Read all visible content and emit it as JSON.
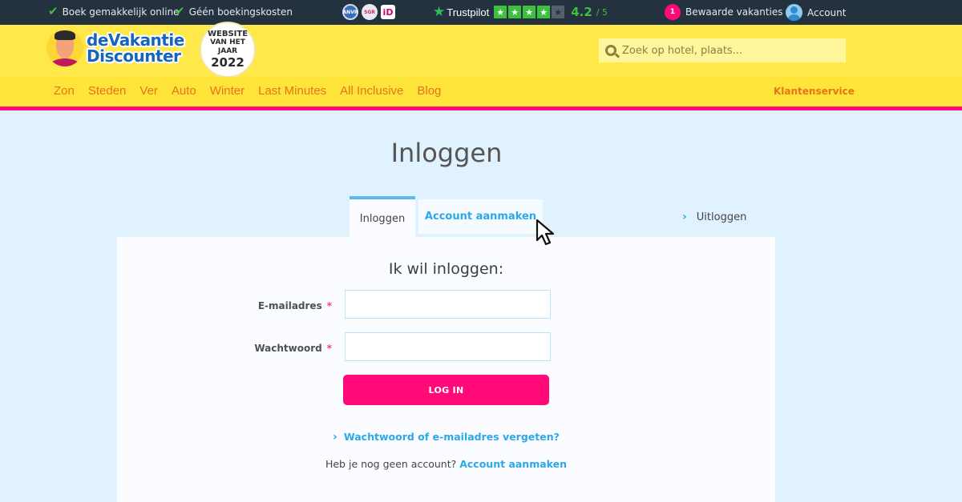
{
  "topbar": {
    "usps": [
      "Boek gemakkelijk online",
      "Géén boekingskosten"
    ],
    "badges": {
      "anvr": "ANVR",
      "sgr": "SGR",
      "ideal": "iD"
    },
    "trustpilot": {
      "name": "Trustpilot",
      "score": "4.2",
      "max": "/ 5",
      "stars_filled": 4,
      "stars_total": 5,
      "star_glyph": "★"
    },
    "saved": {
      "count": "1",
      "label": "Bewaarde vakanties"
    },
    "account_label": "Account",
    "check_glyph": "✔"
  },
  "header": {
    "brand_line1": "deVakantie",
    "brand_line2": "Discounter",
    "award": {
      "l1": "WEBSITE",
      "l2": "VAN HET",
      "l3": "JAAR",
      "l4": "2022"
    },
    "search_placeholder": "Zoek op hotel, plaats..."
  },
  "nav": {
    "items": [
      "Zon",
      "Steden",
      "Ver",
      "Auto",
      "Winter",
      "Last Minutes",
      "All Inclusive",
      "Blog"
    ],
    "service": "Klantenservice"
  },
  "main": {
    "title": "Inloggen",
    "tabs": [
      {
        "label": "Inloggen",
        "active": true
      },
      {
        "label": "Account aanmaken",
        "active": false
      }
    ],
    "logout": "Uitloggen",
    "chevron": "›",
    "form": {
      "heading": "Ik wil inloggen:",
      "email_label": "E-mailadres",
      "email_value": "",
      "password_label": "Wachtwoord",
      "password_value": "",
      "required_mark": "*",
      "submit": "LOG IN",
      "forgot": "Wachtwoord of e-mailadres vergeten?",
      "no_account_text": "Heb je nog geen account?",
      "no_account_link": "Account aanmaken"
    }
  },
  "colors": {
    "accent_pink": "#ff0a78",
    "link_blue": "#2ba8ea",
    "header_yellow": "#ffe94a",
    "topbar_dark": "#24313f",
    "trust_green": "#3ec03e"
  }
}
